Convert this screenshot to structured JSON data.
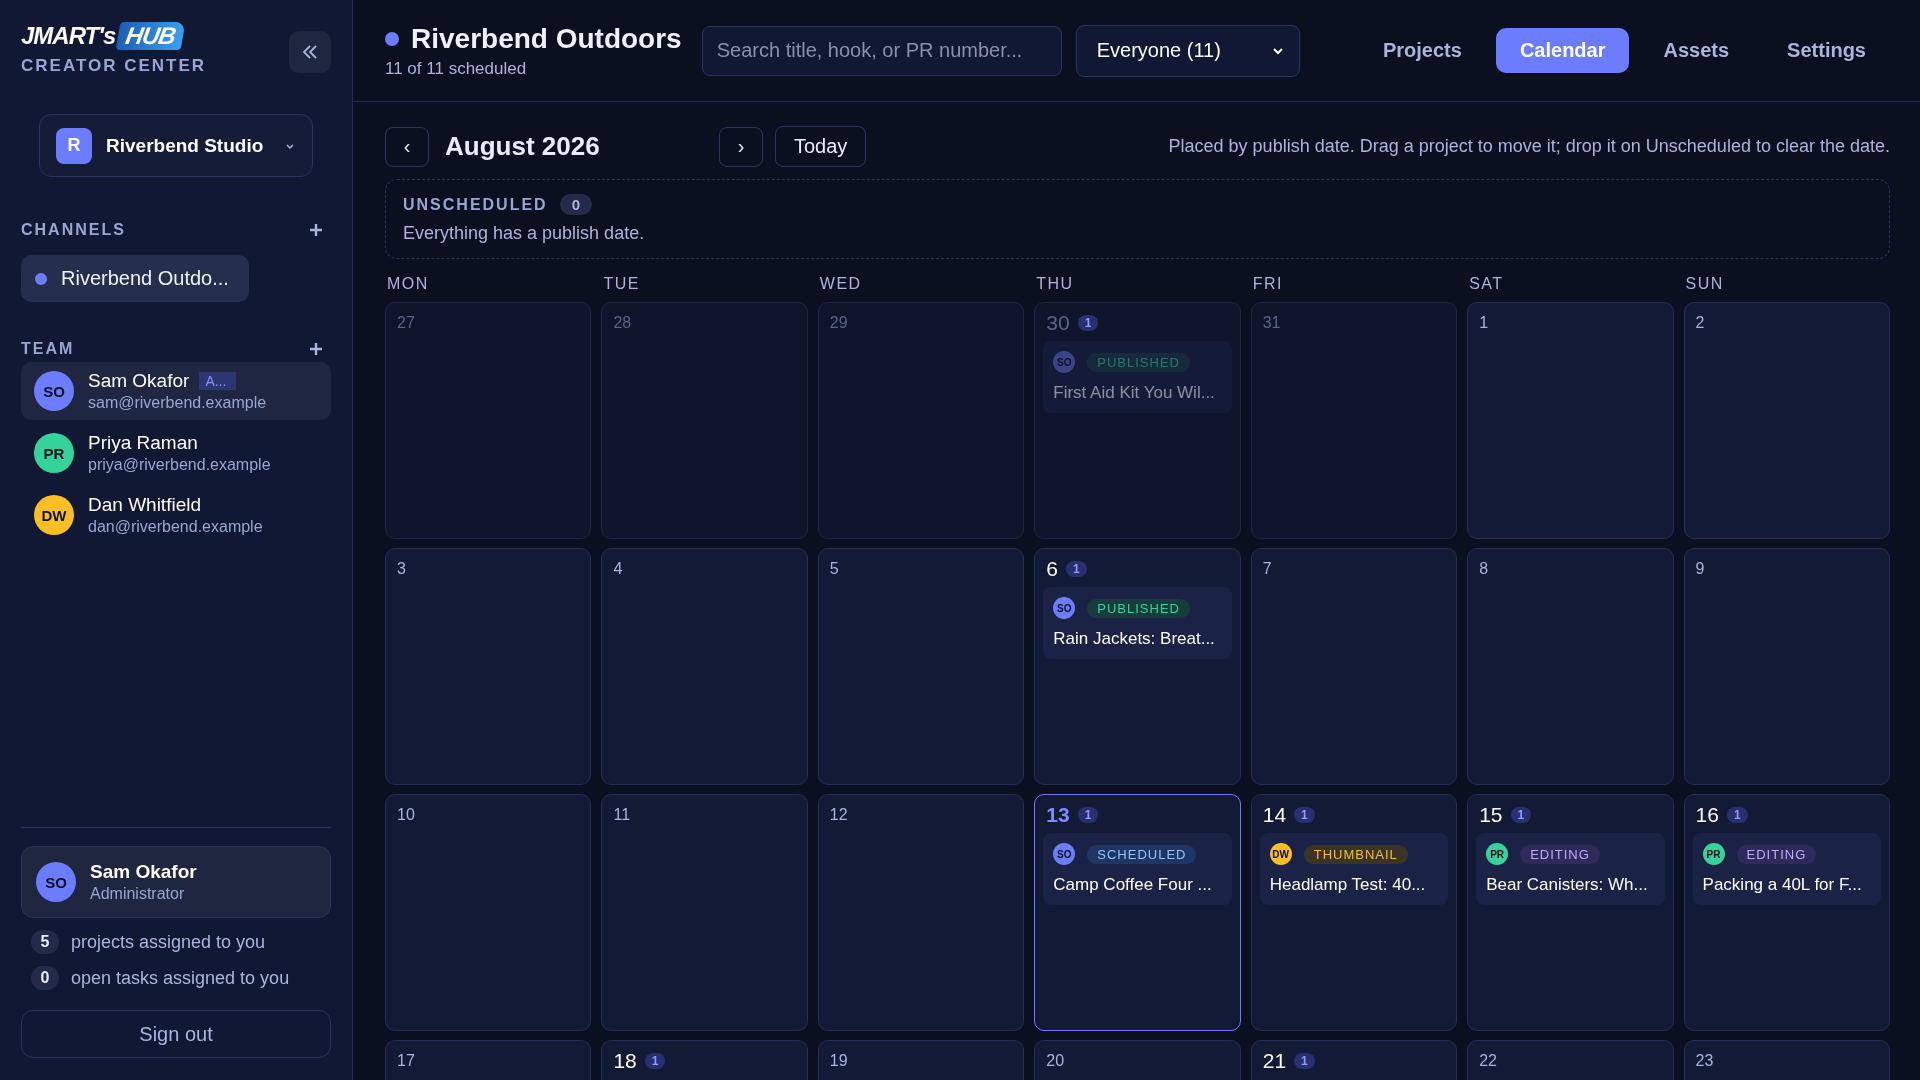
{
  "sidebar": {
    "brand": {
      "name": "JMART's",
      "highlight": "HUB",
      "subtitle": "CREATOR CENTER"
    },
    "workspace": {
      "initial": "R",
      "name": "Riverbend Studio"
    },
    "channels": {
      "heading": "CHANNELS",
      "items": [
        {
          "name": "Riverbend Outdo...",
          "color": "#6b7cff",
          "selected": true
        }
      ]
    },
    "team": {
      "heading": "TEAM",
      "members": [
        {
          "initials": "SO",
          "name": "Sam Okafor",
          "badge": "A...",
          "email": "sam@riverbend.example",
          "color": "#6b7cff",
          "selected": true
        },
        {
          "initials": "PR",
          "name": "Priya Raman",
          "email": "priya@riverbend.example",
          "color": "#34d399",
          "selected": false
        },
        {
          "initials": "DW",
          "name": "Dan Whitfield",
          "email": "dan@riverbend.example",
          "color": "#fbbf24",
          "selected": false
        }
      ]
    },
    "profile": {
      "initials": "SO",
      "name": "Sam Okafor",
      "role": "Administrator",
      "color": "#6b7cff"
    },
    "stats": [
      {
        "count": "5",
        "label": "projects assigned to you"
      },
      {
        "count": "0",
        "label": "open tasks assigned to you"
      }
    ],
    "sign_out": "Sign out"
  },
  "header": {
    "channel": {
      "name": "Riverbend Outdoors",
      "color": "#6b7cff",
      "subtitle": "11 of 11 scheduled"
    },
    "search": {
      "placeholder": "Search title, hook, or PR number..."
    },
    "filter": {
      "value": "Everyone (11)"
    },
    "tabs": [
      {
        "label": "Projects",
        "selected": false
      },
      {
        "label": "Calendar",
        "selected": true
      },
      {
        "label": "Assets",
        "selected": false
      },
      {
        "label": "Settings",
        "selected": false
      }
    ]
  },
  "calendar": {
    "prev": "‹",
    "month": "August 2026",
    "next": "›",
    "today": "Today",
    "hint": "Placed by publish date. Drag a project to move it; drop it on Unscheduled to clear the date.",
    "unscheduled": {
      "label": "UNSCHEDULED",
      "count": "0",
      "message": "Everything has a publish date."
    },
    "weekdays": [
      "MON",
      "TUE",
      "WED",
      "THU",
      "FRI",
      "SAT",
      "SUN"
    ],
    "weeks": [
      {
        "days": [
          {
            "number": "27",
            "in_month": false,
            "today": false
          },
          {
            "number": "28",
            "in_month": false,
            "today": false
          },
          {
            "number": "29",
            "in_month": false,
            "today": false
          },
          {
            "number": "30",
            "in_month": false,
            "today": false,
            "count": "1",
            "events": [
              {
                "initials": "SO",
                "color": "#3b4486",
                "status": "PUBLISHED",
                "kind": "published",
                "title": "First Aid Kit You Wil..."
              }
            ]
          },
          {
            "number": "31",
            "in_month": false,
            "today": false
          },
          {
            "number": "1",
            "in_month": true,
            "today": false
          },
          {
            "number": "2",
            "in_month": true,
            "today": false
          }
        ]
      },
      {
        "days": [
          {
            "number": "3",
            "in_month": true,
            "today": false
          },
          {
            "number": "4",
            "in_month": true,
            "today": false
          },
          {
            "number": "5",
            "in_month": true,
            "today": false
          },
          {
            "number": "6",
            "in_month": true,
            "today": false,
            "count": "1",
            "events": [
              {
                "initials": "SO",
                "color": "#6b7cff",
                "status": "PUBLISHED",
                "kind": "published",
                "title": "Rain Jackets: Breat..."
              }
            ]
          },
          {
            "number": "7",
            "in_month": true,
            "today": false
          },
          {
            "number": "8",
            "in_month": true,
            "today": false
          },
          {
            "number": "9",
            "in_month": true,
            "today": false
          }
        ]
      },
      {
        "days": [
          {
            "number": "10",
            "in_month": true,
            "today": false
          },
          {
            "number": "11",
            "in_month": true,
            "today": false
          },
          {
            "number": "12",
            "in_month": true,
            "today": false
          },
          {
            "number": "13",
            "in_month": true,
            "today": true,
            "count": "1",
            "events": [
              {
                "initials": "SO",
                "color": "#6b7cff",
                "status": "SCHEDULED",
                "kind": "scheduled",
                "title": "Camp Coffee Four ..."
              }
            ]
          },
          {
            "number": "14",
            "in_month": true,
            "today": false,
            "count": "1",
            "events": [
              {
                "initials": "DW",
                "color": "#fbbf24",
                "status": "THUMBNAIL",
                "kind": "thumbnail",
                "title": "Headlamp Test: 40..."
              }
            ]
          },
          {
            "number": "15",
            "in_month": true,
            "today": false,
            "count": "1",
            "events": [
              {
                "initials": "PR",
                "color": "#34d399",
                "status": "EDITING",
                "kind": "editing",
                "title": "Bear Canisters: Wh..."
              }
            ]
          },
          {
            "number": "16",
            "in_month": true,
            "today": false,
            "count": "1",
            "events": [
              {
                "initials": "PR",
                "color": "#34d399",
                "status": "EDITING",
                "kind": "editing",
                "title": "Packing a 40L for F..."
              }
            ]
          }
        ]
      },
      {
        "days": [
          {
            "number": "17",
            "in_month": true,
            "today": false
          },
          {
            "number": "18",
            "in_month": true,
            "today": false,
            "count": "1"
          },
          {
            "number": "19",
            "in_month": true,
            "today": false
          },
          {
            "number": "20",
            "in_month": true,
            "today": false
          },
          {
            "number": "21",
            "in_month": true,
            "today": false,
            "count": "1"
          },
          {
            "number": "22",
            "in_month": true,
            "today": false
          },
          {
            "number": "23",
            "in_month": true,
            "today": false
          }
        ]
      }
    ]
  }
}
